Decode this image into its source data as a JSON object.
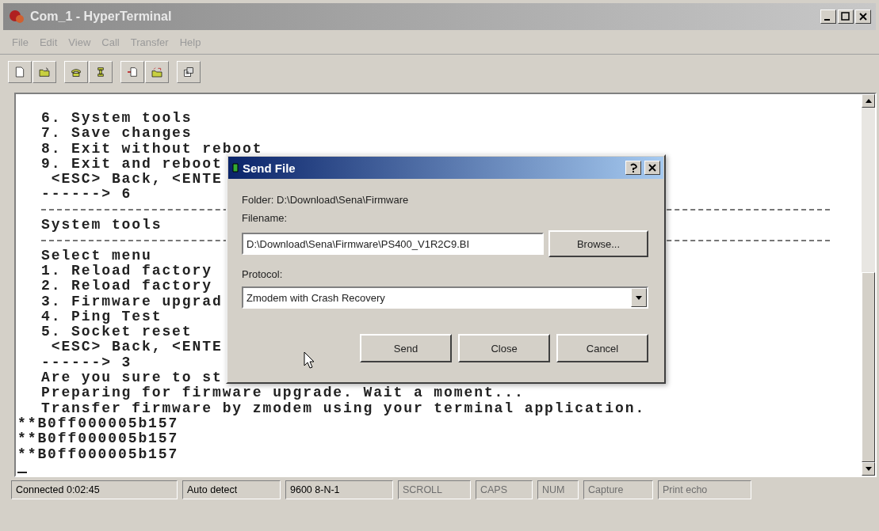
{
  "window": {
    "title": "Com_1 - HyperTerminal"
  },
  "menu": [
    "File",
    "Edit",
    "View",
    "Call",
    "Transfer",
    "Help"
  ],
  "terminal": {
    "lines": [
      {
        "kind": "text",
        "text": "6. System tools"
      },
      {
        "kind": "text",
        "text": "7. Save changes"
      },
      {
        "kind": "text",
        "text": "8. Exit without reboot"
      },
      {
        "kind": "text",
        "text": "9. Exit and reboot"
      },
      {
        "kind": "text",
        "text": " <ESC> Back, <ENTE"
      },
      {
        "kind": "text",
        "text": "------> 6"
      },
      {
        "kind": "rule"
      },
      {
        "kind": "text",
        "text": "System tools"
      },
      {
        "kind": "rule"
      },
      {
        "kind": "text",
        "text": "Select menu"
      },
      {
        "kind": "text",
        "text": "1. Reload factory"
      },
      {
        "kind": "text",
        "text": "2. Reload factory"
      },
      {
        "kind": "text",
        "text": "3. Firmware upgrad"
      },
      {
        "kind": "text",
        "text": "4. Ping Test"
      },
      {
        "kind": "text",
        "text": "5. Socket reset"
      },
      {
        "kind": "text",
        "text": " <ESC> Back, <ENTE"
      },
      {
        "kind": "text",
        "text": "------> 3"
      },
      {
        "kind": "text",
        "text": "Are you sure to st"
      },
      {
        "kind": "text",
        "text": "Preparing for firmware upgrade. Wait a moment..."
      },
      {
        "kind": "text",
        "text": "Transfer firmware by zmodem using your terminal application."
      },
      {
        "kind": "data",
        "text": "**B0ff000005b157"
      },
      {
        "kind": "data",
        "text": "**B0ff000005b157"
      },
      {
        "kind": "data",
        "text": "**B0ff000005b157"
      },
      {
        "kind": "cursor"
      }
    ]
  },
  "dialog": {
    "title": "Send File",
    "folder": "Folder:  D:\\Download\\Sena\\Firmware",
    "filename_label": "Filename:",
    "filename": "D:\\Download\\Sena\\Firmware\\PS400_V1R2C9.BI",
    "browse": "Browse...",
    "protocol_label": "Protocol:",
    "protocol": "Zmodem with Crash Recovery",
    "buttons": [
      "Send",
      "Close",
      "Cancel"
    ]
  },
  "status_bar": [
    {
      "text": "Connected 0:02:45",
      "disabled": false
    },
    {
      "text": "Auto detect",
      "disabled": false
    },
    {
      "text": "9600 8-N-1",
      "disabled": false
    },
    {
      "text": "SCROLL",
      "disabled": true
    },
    {
      "text": "CAPS",
      "disabled": true
    },
    {
      "text": "NUM",
      "disabled": true
    },
    {
      "text": "Capture",
      "disabled": true
    },
    {
      "text": "Print echo",
      "disabled": true
    }
  ]
}
